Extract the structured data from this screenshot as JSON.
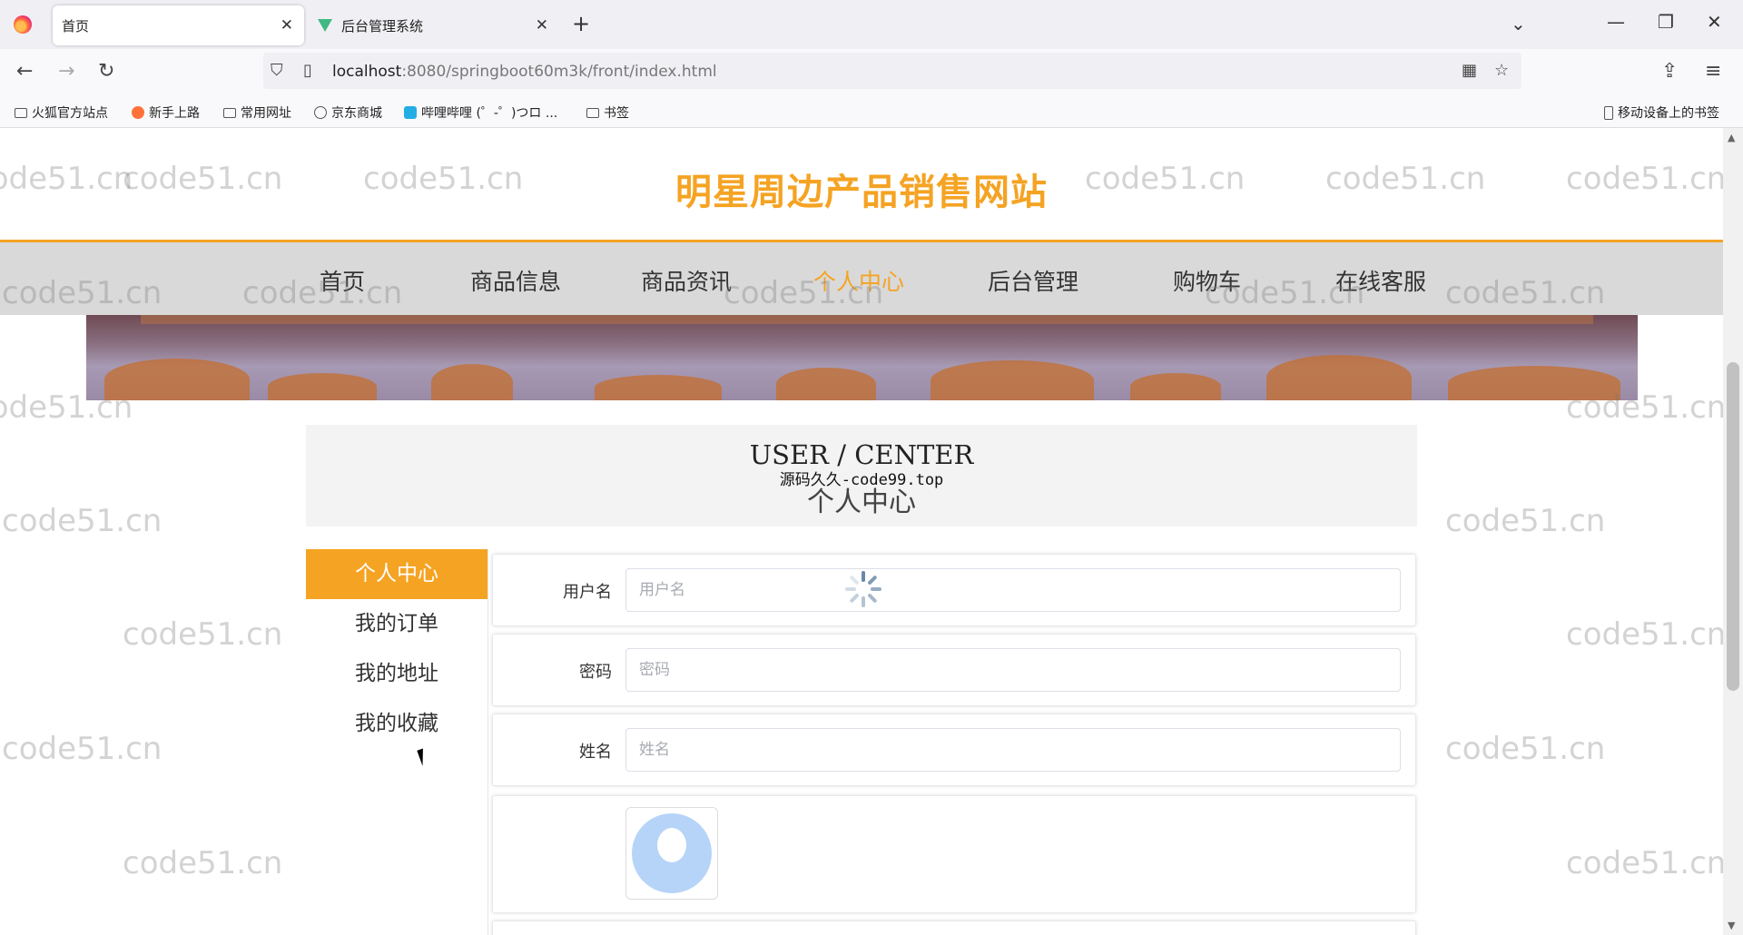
{
  "browser": {
    "tabs": [
      {
        "label": "首页",
        "active": true
      },
      {
        "label": "后台管理系统",
        "active": false
      }
    ],
    "url_host": "localhost",
    "url_rest": ":8080/springboot60m3k/front/index.html",
    "bookmarks": [
      "火狐官方站点",
      "新手上路",
      "常用网址",
      "京东商城",
      "哔哩哔哩 (゜-゜)つロ ...",
      "书签"
    ],
    "mobile_bookmarks": "移动设备上的书签"
  },
  "site": {
    "title": "明星周边产品销售网站",
    "menu": [
      "首页",
      "商品信息",
      "商品资讯",
      "个人中心",
      "后台管理",
      "购物车",
      "在线客服"
    ],
    "active_menu": "个人中心"
  },
  "user_center": {
    "heading_en": "USER / CENTER",
    "heading_zh": "个人中心",
    "overlay_text": "源码久久-code99.top",
    "side_menu": [
      "个人中心",
      "我的订单",
      "我的地址",
      "我的收藏"
    ],
    "fields": [
      {
        "label": "用户名",
        "placeholder": "用户名",
        "value": ""
      },
      {
        "label": "密码",
        "placeholder": "密码",
        "value": ""
      },
      {
        "label": "姓名",
        "placeholder": "姓名",
        "value": ""
      }
    ]
  },
  "watermark": "code51.cn",
  "colors": {
    "accent": "#f5a323",
    "menu_bg": "#d9d9d9"
  }
}
